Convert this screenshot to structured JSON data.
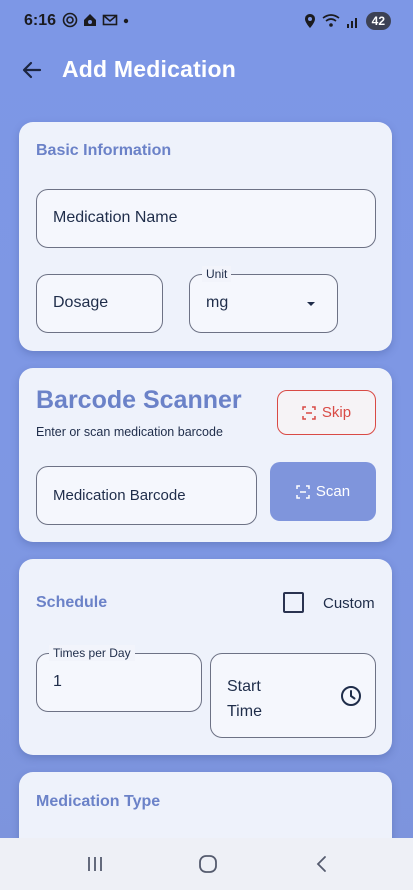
{
  "status_bar": {
    "time": "6:16",
    "battery": "42"
  },
  "app_bar": {
    "title": "Add Medication"
  },
  "basic_info": {
    "section_title": "Basic Information",
    "medication_name_label": "Medication Name",
    "dosage_label": "Dosage",
    "unit_label": "Unit",
    "unit_value": "mg"
  },
  "barcode": {
    "section_title": "Barcode Scanner",
    "subtitle": "Enter or scan medication barcode",
    "skip_label": "Skip",
    "barcode_field_label": "Medication Barcode",
    "scan_label": "Scan"
  },
  "schedule": {
    "section_title": "Schedule",
    "custom_label": "Custom",
    "custom_checked": false,
    "times_per_day_label": "Times per Day",
    "times_per_day_value": "1",
    "start_time_label_line1": "Start",
    "start_time_label_line2": "Time"
  },
  "medication_type": {
    "section_title": "Medication Type"
  },
  "colors": {
    "accent": "#7f95dc",
    "section_title": "#6b82c8",
    "skip_red": "#d94a45",
    "background": "#7d97e6"
  }
}
